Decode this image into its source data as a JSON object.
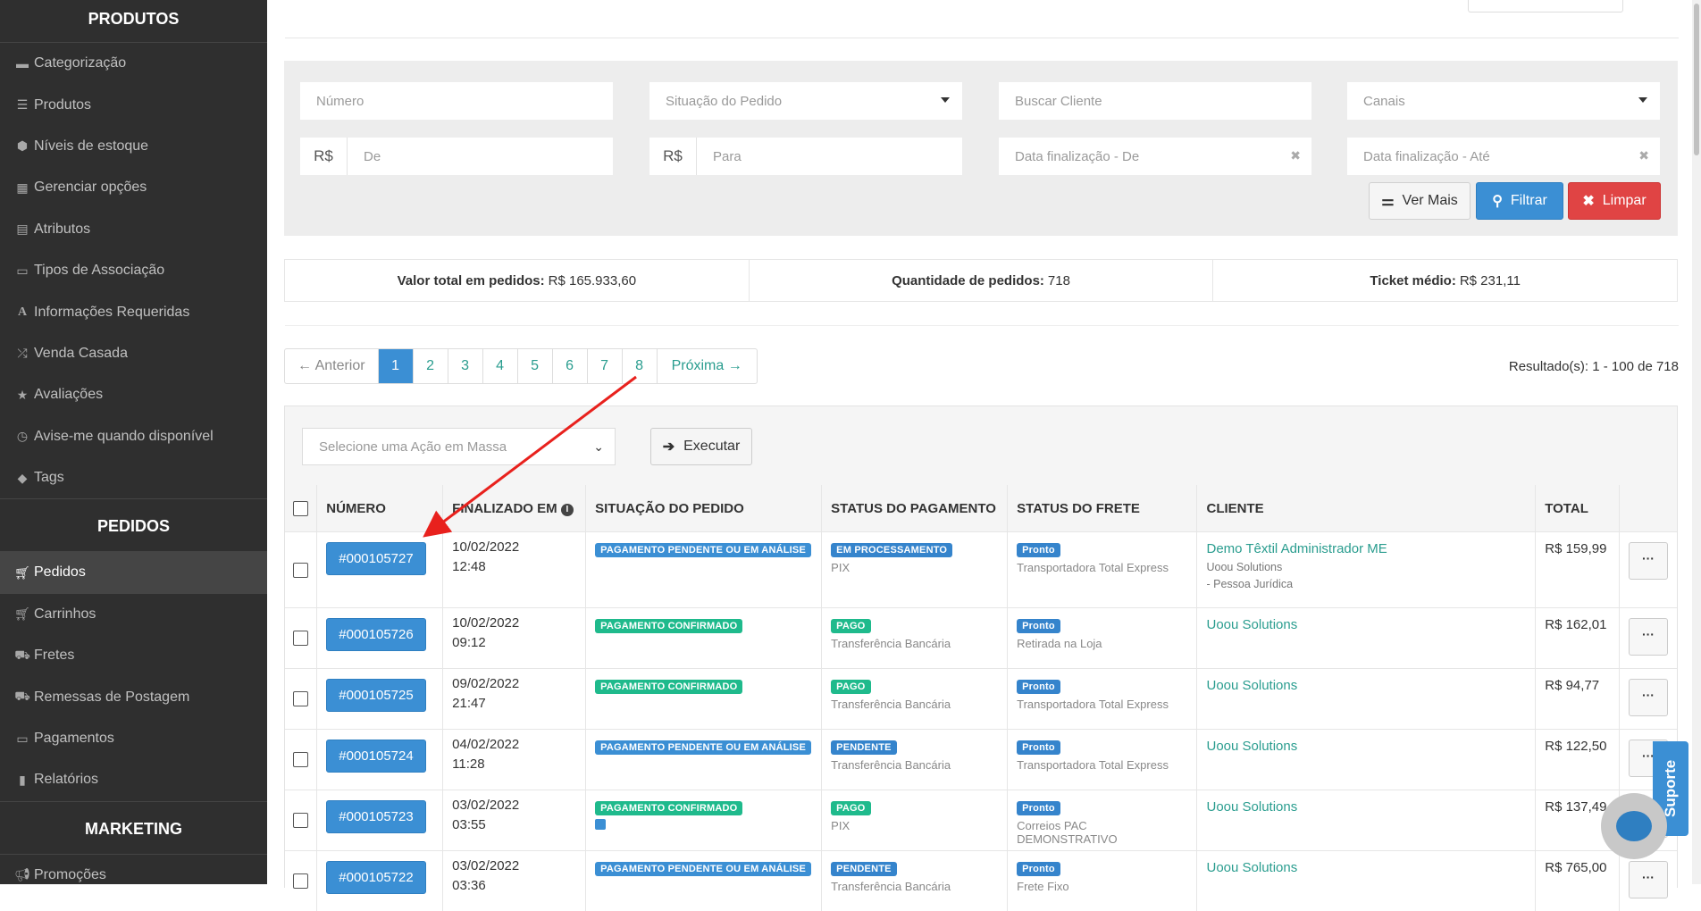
{
  "sidebar": {
    "produtos_title": "PRODUTOS",
    "produtos_items": [
      "Categorização",
      "Produtos",
      "Níveis de estoque",
      "Gerenciar opções",
      "Atributos",
      "Tipos de Associação",
      "Informações Requeridas",
      "Venda Casada",
      "Avaliações",
      "Avise-me quando disponível",
      "Tags"
    ],
    "pedidos_title": "PEDIDOS",
    "pedidos_items": [
      "Pedidos",
      "Carrinhos",
      "Fretes",
      "Remessas de Postagem",
      "Pagamentos",
      "Relatórios"
    ],
    "marketing_title": "MARKETING",
    "marketing_items": [
      "Promoções"
    ]
  },
  "filters": {
    "numero_placeholder": "Número",
    "situacao_placeholder": "Situação do Pedido",
    "cliente_placeholder": "Buscar Cliente",
    "canais_placeholder": "Canais",
    "currency": "R$",
    "de_placeholder": "De",
    "para_placeholder": "Para",
    "data_de_placeholder": "Data finalização - De",
    "data_ate_placeholder": "Data finalização - Até",
    "clear_mark": "✖",
    "ver_mais": "Ver Mais",
    "filtrar": "Filtrar",
    "limpar": "Limpar"
  },
  "stats": {
    "total_label": "Valor total em pedidos:",
    "total_value": "R$ 165.933,60",
    "qty_label": "Quantidade de pedidos:",
    "qty_value": "718",
    "ticket_label": "Ticket médio:",
    "ticket_value": "R$ 231,11"
  },
  "pagination": {
    "prev": "← Anterior",
    "pages": [
      "1",
      "2",
      "3",
      "4",
      "5",
      "6",
      "7",
      "8"
    ],
    "current": "1",
    "next": "Próxima →",
    "result_text": "Resultado(s): 1 - 100 de 718"
  },
  "mass_action": {
    "placeholder": "Selecione uma Ação em Massa",
    "execute": "Executar"
  },
  "table": {
    "headers": [
      "NÚMERO",
      "FINALIZADO EM",
      "SITUAÇÃO DO PEDIDO",
      "STATUS DO PAGAMENTO",
      "STATUS DO FRETE",
      "CLIENTE",
      "TOTAL"
    ],
    "rows": [
      {
        "numero": "#000105727",
        "date": "10/02/2022",
        "time": "12:48",
        "situacao": "PAGAMENTO PENDENTE OU EM ANÁLISE",
        "pagamento": "EM PROCESSAMENTO",
        "metodo": "PIX",
        "frete": "Pronto",
        "transportadora": "Transportadora Total Express",
        "cliente": "Demo Têxtil Administrador ME",
        "cliente_sub1": "Uoou Solutions",
        "cliente_sub2": "- Pessoa Jurídica",
        "total": "R$ 159,99"
      },
      {
        "numero": "#000105726",
        "date": "10/02/2022",
        "time": "09:12",
        "situacao": "PAGAMENTO CONFIRMADO",
        "pagamento": "PAGO",
        "metodo": "Transferência Bancária",
        "frete": "Pronto",
        "transportadora": "Retirada na Loja",
        "cliente": "Uoou Solutions",
        "cliente_sub1": "",
        "cliente_sub2": "",
        "total": "R$ 162,01"
      },
      {
        "numero": "#000105725",
        "date": "09/02/2022",
        "time": "21:47",
        "situacao": "PAGAMENTO CONFIRMADO",
        "pagamento": "PAGO",
        "metodo": "Transferência Bancária",
        "frete": "Pronto",
        "transportadora": "Transportadora Total Express",
        "cliente": "Uoou Solutions",
        "cliente_sub1": "",
        "cliente_sub2": "",
        "total": "R$ 94,77"
      },
      {
        "numero": "#000105724",
        "date": "04/02/2022",
        "time": "11:28",
        "situacao": "PAGAMENTO PENDENTE OU EM ANÁLISE",
        "pagamento": "PENDENTE",
        "metodo": "Transferência Bancária",
        "frete": "Pronto",
        "transportadora": "Transportadora Total Express",
        "cliente": "Uoou Solutions",
        "cliente_sub1": "",
        "cliente_sub2": "",
        "total": "R$ 122,50"
      },
      {
        "numero": "#000105723",
        "date": "03/02/2022",
        "time": "03:55",
        "situacao": "PAGAMENTO CONFIRMADO",
        "pagamento": "PAGO",
        "metodo": "PIX",
        "frete": "Pronto",
        "transportadora": "Correios PAC DEMONSTRATIVO",
        "cliente": "Uoou Solutions",
        "cliente_sub1": "",
        "cliente_sub2": "",
        "total": "R$ 137,49"
      },
      {
        "numero": "#000105722",
        "date": "03/02/2022",
        "time": "03:36",
        "situacao": "PAGAMENTO PENDENTE OU EM ANÁLISE",
        "pagamento": "PENDENTE",
        "metodo": "Transferência Bancária",
        "frete": "Pronto",
        "transportadora": "Frete Fixo",
        "cliente": "Uoou Solutions",
        "cliente_sub1": "",
        "cliente_sub2": "",
        "total": "R$ 765,00"
      }
    ],
    "more_label": "···"
  },
  "widgets": {
    "suporte": "Suporte"
  },
  "colors": {
    "accent": "#3b8fd4",
    "success": "#1fba8c",
    "danger": "#e04444",
    "link": "#2a9d8f",
    "sidebar": "#2f2f2f",
    "annotation_arrow": "#e8211d"
  }
}
